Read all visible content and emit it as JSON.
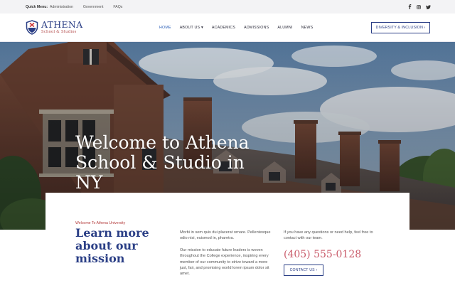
{
  "topbar": {
    "quick_menu": "Quick Menu:",
    "links": [
      "Administration",
      "Government",
      "FAQs"
    ],
    "social": [
      {
        "icon": "facebook-icon"
      },
      {
        "icon": "instagram-icon"
      },
      {
        "icon": "twitter-icon"
      }
    ]
  },
  "header": {
    "brand": "ATHENA",
    "brand_sub": "School & Studios",
    "nav": [
      "HOME",
      "ABOUT US ▾",
      "ACADEMICS",
      "ADMISSIONS",
      "ALUMNI",
      "NEWS"
    ],
    "active_nav": "HOME",
    "cta_label": "DIVERSITY & INCLUSION ›"
  },
  "hero": {
    "title": "Welcome to Athena School & Studio in NY"
  },
  "intro": {
    "eyebrow": "Welcome To Athena University",
    "heading": "Learn more about our mission",
    "para1": "Morbi in sem quis dui placerat ornare. Pellentesque odio nisi, euismod in, pharetra.",
    "para2": "Our mission to educate future leaders is woven throughout the College experience, inspiring every member of our community to strive toward a more just, fair, and promising world lorem ipsum dolor sit amet.",
    "contact_text": "If you have any questions or need help, feel free to contact with our team.",
    "phone": "(405) 555-0128",
    "contact_label": "CONTACT US ›"
  },
  "colors": {
    "brand_blue": "#2b3f86",
    "accent_red": "#b33b3b",
    "phone_pink": "#c95b6a"
  }
}
